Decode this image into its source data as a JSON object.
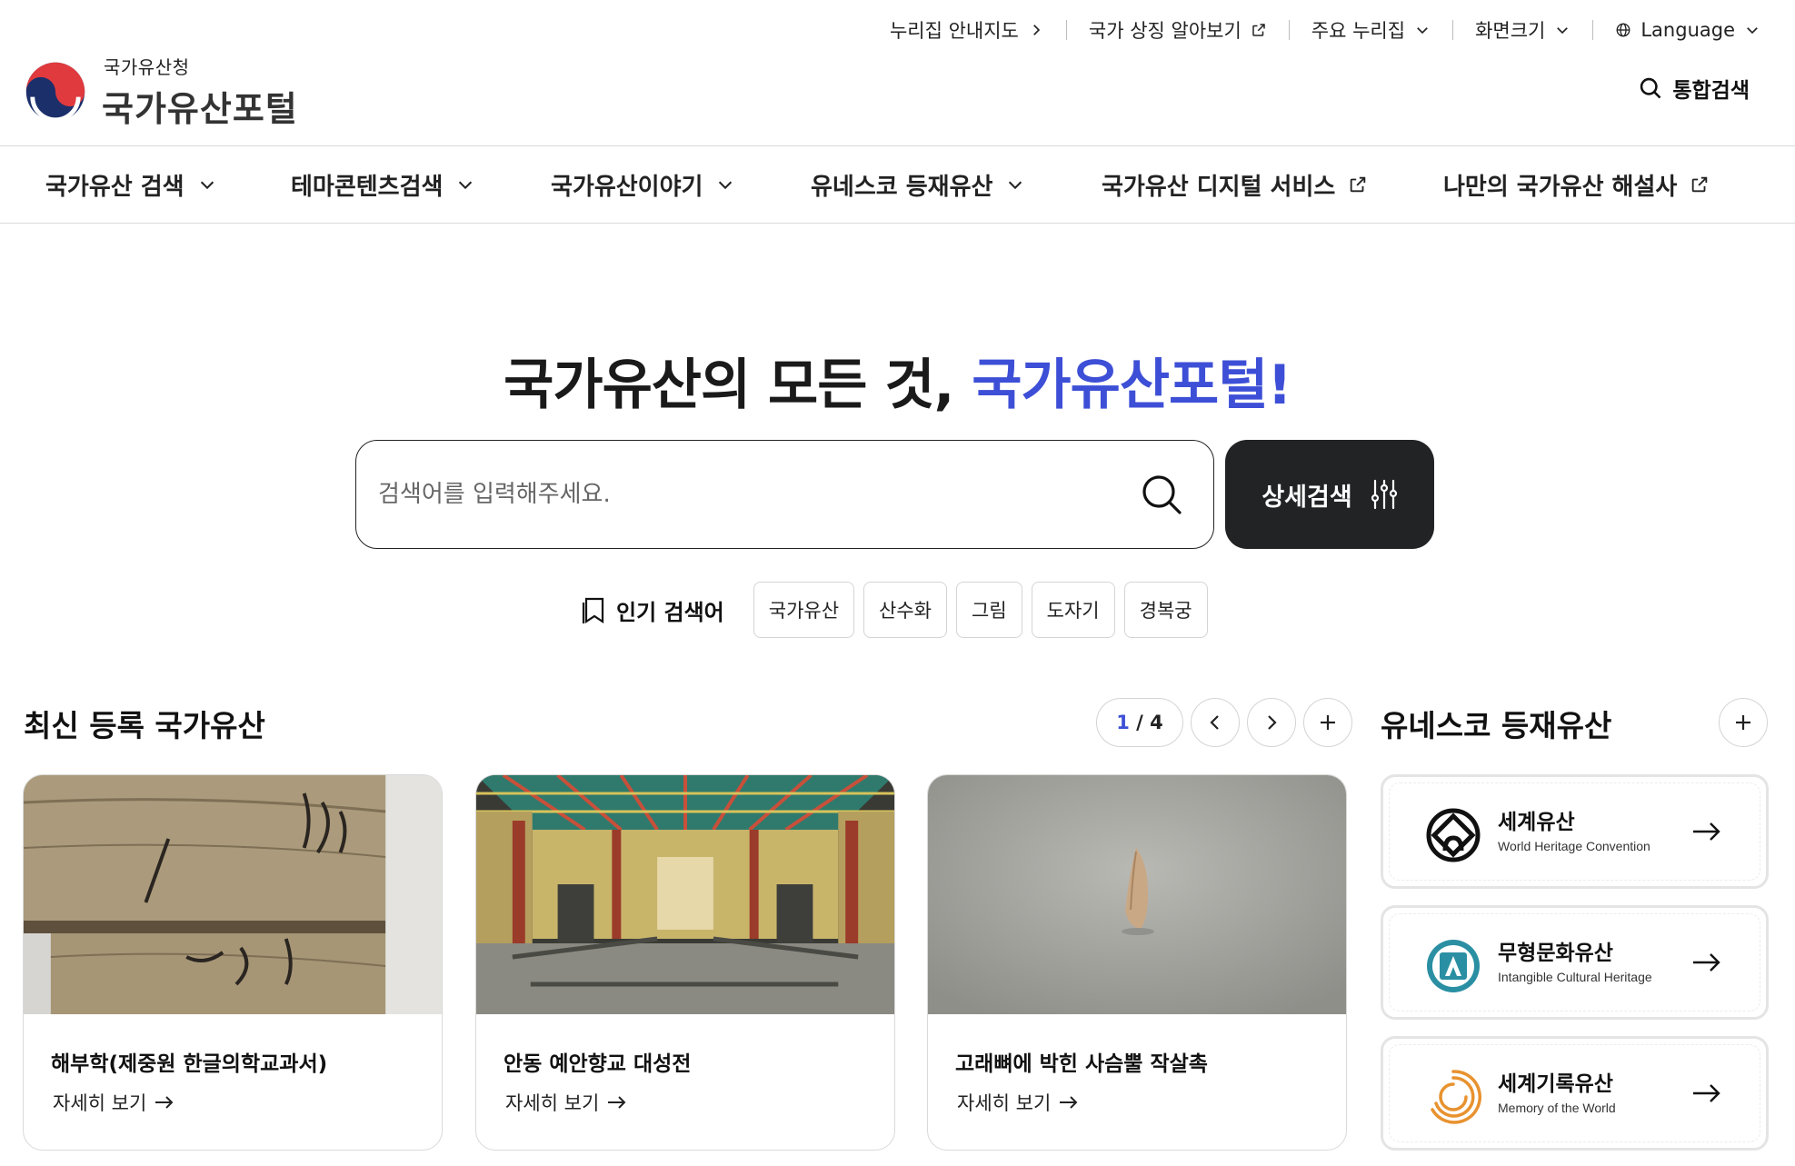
{
  "utility": {
    "guide_map": "누리집 안내지도",
    "symbols": "국가 상징 알아보기",
    "major_sites": "주요 누리집",
    "font_size": "화면크기",
    "language": "Language"
  },
  "logo": {
    "agency": "국가유산청",
    "title": "국가유산포털"
  },
  "total_search": "통합검색",
  "gnb": [
    {
      "label": "국가유산 검색",
      "icon": "chevron-down-icon"
    },
    {
      "label": "테마콘텐츠검색",
      "icon": "chevron-down-icon"
    },
    {
      "label": "국가유산이야기",
      "icon": "chevron-down-icon"
    },
    {
      "label": "유네스코 등재유산",
      "icon": "chevron-down-icon"
    },
    {
      "label": "국가유산 디지털 서비스",
      "icon": "external-link-icon"
    },
    {
      "label": "나만의 국가유산 해설사",
      "icon": "external-link-icon"
    }
  ],
  "hero": {
    "title_prefix": "국가유산의 모든 것, ",
    "title_accent": "국가유산포털!"
  },
  "search": {
    "placeholder": "검색어를 입력해주세요.",
    "detail_label": "상세검색"
  },
  "popular": {
    "label": "인기 검색어",
    "tags": [
      "국가유산",
      "산수화",
      "그림",
      "도자기",
      "경복궁"
    ]
  },
  "recent": {
    "title": "최신 등록 국가유산",
    "page_current": "1",
    "page_total": "4",
    "cards": [
      {
        "title": "해부학(제중원 한글의학교과서)",
        "more": "자세히 보기"
      },
      {
        "title": "안동 예안향교 대성전",
        "more": "자세히 보기"
      },
      {
        "title": "고래뼈에 박힌 사슴뿔 작살촉",
        "more": "자세히 보기"
      }
    ]
  },
  "unesco": {
    "title": "유네스코 등재유산",
    "items": [
      {
        "name": "세계유산",
        "sub": "World Heritage Convention",
        "icon": "world-heritage-icon"
      },
      {
        "name": "무형문화유산",
        "sub": "Intangible Cultural Heritage",
        "icon": "intangible-heritage-icon"
      },
      {
        "name": "세계기록유산",
        "sub": "Memory of the World",
        "icon": "memory-of-world-icon"
      }
    ]
  },
  "colors": {
    "accent": "#3d4fd6",
    "dark_button": "#222325",
    "intangible_teal": "#2b8fa3",
    "memory_orange": "#e8922f"
  }
}
